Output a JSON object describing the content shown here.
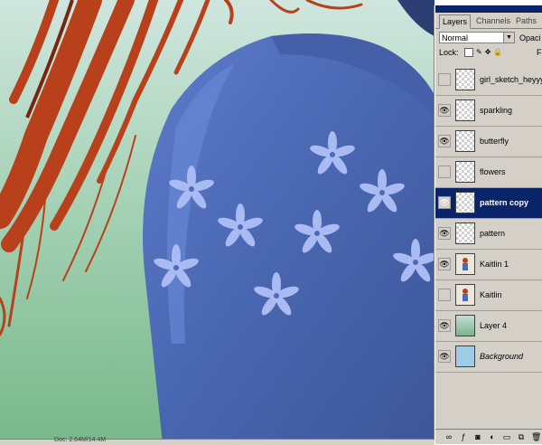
{
  "palette": {
    "tabs": [
      "Layers",
      "Channels",
      "Paths"
    ],
    "blend_mode": "Normal",
    "opacity_label": "Opaci",
    "lock_label": "Lock:",
    "fill_label": "F",
    "layers": [
      {
        "name": "girl_sketch_heyyy",
        "visible": false,
        "thumb": "checker",
        "selected": false,
        "italic": false
      },
      {
        "name": "sparkling",
        "visible": true,
        "thumb": "checker",
        "selected": false,
        "italic": false
      },
      {
        "name": "butterfly",
        "visible": true,
        "thumb": "checker",
        "selected": false,
        "italic": false
      },
      {
        "name": "flowers",
        "visible": false,
        "thumb": "checker",
        "selected": false,
        "italic": false
      },
      {
        "name": "pattern copy",
        "visible": true,
        "thumb": "checker",
        "selected": true,
        "italic": false
      },
      {
        "name": "pattern",
        "visible": true,
        "thumb": "checker",
        "selected": false,
        "italic": false
      },
      {
        "name": "Kaitlin  1",
        "visible": true,
        "thumb": "kaitlin",
        "selected": false,
        "italic": false
      },
      {
        "name": "Kaitlin",
        "visible": false,
        "thumb": "kaitlin",
        "selected": false,
        "italic": false
      },
      {
        "name": "Layer 4",
        "visible": true,
        "thumb": "layer4",
        "selected": false,
        "italic": false
      },
      {
        "name": "Background",
        "visible": true,
        "thumb": "bg",
        "selected": false,
        "italic": true
      }
    ]
  },
  "colors": {
    "hair": "#b8401a",
    "sweater": "#4d6ab4",
    "flowers": "#a9bbf2",
    "background_green": "#9ccaa8",
    "selection": "#0a246a"
  },
  "status": {
    "text": "Doc: 2.64M/14.4M"
  }
}
